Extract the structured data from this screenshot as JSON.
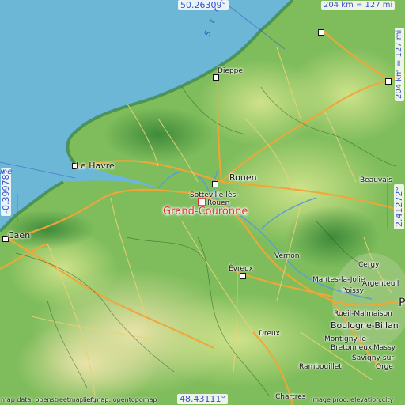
{
  "map": {
    "highlight": "Grand-Couronne",
    "colors": {
      "sea": "#6cb6d6",
      "lowland": "#7fbf5f",
      "upland": "#cfe08a",
      "highland": "#e7e3a0",
      "roads": "#f2a637",
      "highlight": "#e0302a",
      "coord_text": "#3b4fc8"
    },
    "coords": {
      "top": "50.26309°",
      "bottom": "48.43111°",
      "left": "-0.39978°",
      "right": "2.41272°"
    },
    "scale": {
      "top": "204 km = 127 mi",
      "right": "204 km = 127 mi"
    },
    "sea_label": "S t r a",
    "left_edge_text": "ine",
    "places": {
      "dieppe": "Dieppe",
      "le_havre": "Le Havre",
      "rouen": "Rouen",
      "sotteville_1": "Sotteville-lès-",
      "sotteville_2": "Rouen",
      "caen": "Caen",
      "beauvais": "Beauvais",
      "vernon": "Vernon",
      "evreux": "Évreux",
      "cergy": "Cergy",
      "mantes": "Mantes-la-Jolie",
      "argenteuil": "Argenteuil",
      "poissy": "Poissy",
      "rueil": "Rueil-Malmaison",
      "boulogne": "Boulogne-Billan",
      "dreux": "Dreux",
      "montigny_1": "Montigny-le-",
      "montigny_2": "Bretonneux",
      "massy": "Massy",
      "savigny": "Savigny-sur-",
      "orge": "Orge",
      "rambouillet": "Rambouillet",
      "chartres": "Chartres",
      "paris_initial": "P"
    },
    "attribution": {
      "left": "map data: openstreetmap.org",
      "left2": "lief map: opentopomap",
      "right": "image proc: elevation.city"
    }
  }
}
